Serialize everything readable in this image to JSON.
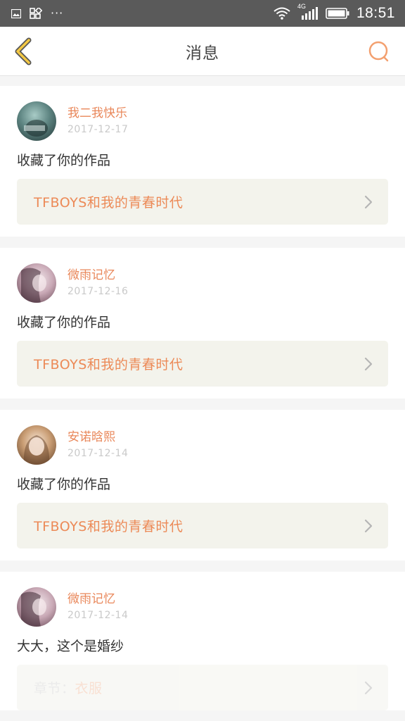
{
  "status_bar": {
    "network": "4G",
    "time": "18:51",
    "more": "···"
  },
  "header": {
    "title": "消息"
  },
  "messages": [
    {
      "username": "我二我快乐",
      "date": "2017-12-17",
      "text": "收藏了你的作品",
      "work_title": "TFBOYS和我的青春时代",
      "avatar_tint": [
        "#2f4a4a",
        "#93b8b3"
      ]
    },
    {
      "username": "微雨记忆",
      "date": "2017-12-16",
      "text": "收藏了你的作品",
      "work_title": "TFBOYS和我的青春时代",
      "avatar_tint": [
        "#6b4a58",
        "#d7c4cc"
      ]
    },
    {
      "username": "安诺晗熙",
      "date": "2017-12-14",
      "text": "收藏了你的作品",
      "work_title": "TFBOYS和我的青春时代",
      "avatar_tint": [
        "#7a5a3a",
        "#e8cdb0"
      ]
    },
    {
      "username": "微雨记忆",
      "date": "2017-12-14",
      "text": "大大，这个是婚纱",
      "chapter_label": "章节：",
      "chapter_value": "衣服",
      "avatar_tint": [
        "#6b4a58",
        "#d7c4cc"
      ]
    }
  ],
  "colors": {
    "accent": "#ec8a57",
    "back_arrow": "#f2c744",
    "search_icon": "#f3a06f",
    "statusbar": "#5a5a5a"
  }
}
